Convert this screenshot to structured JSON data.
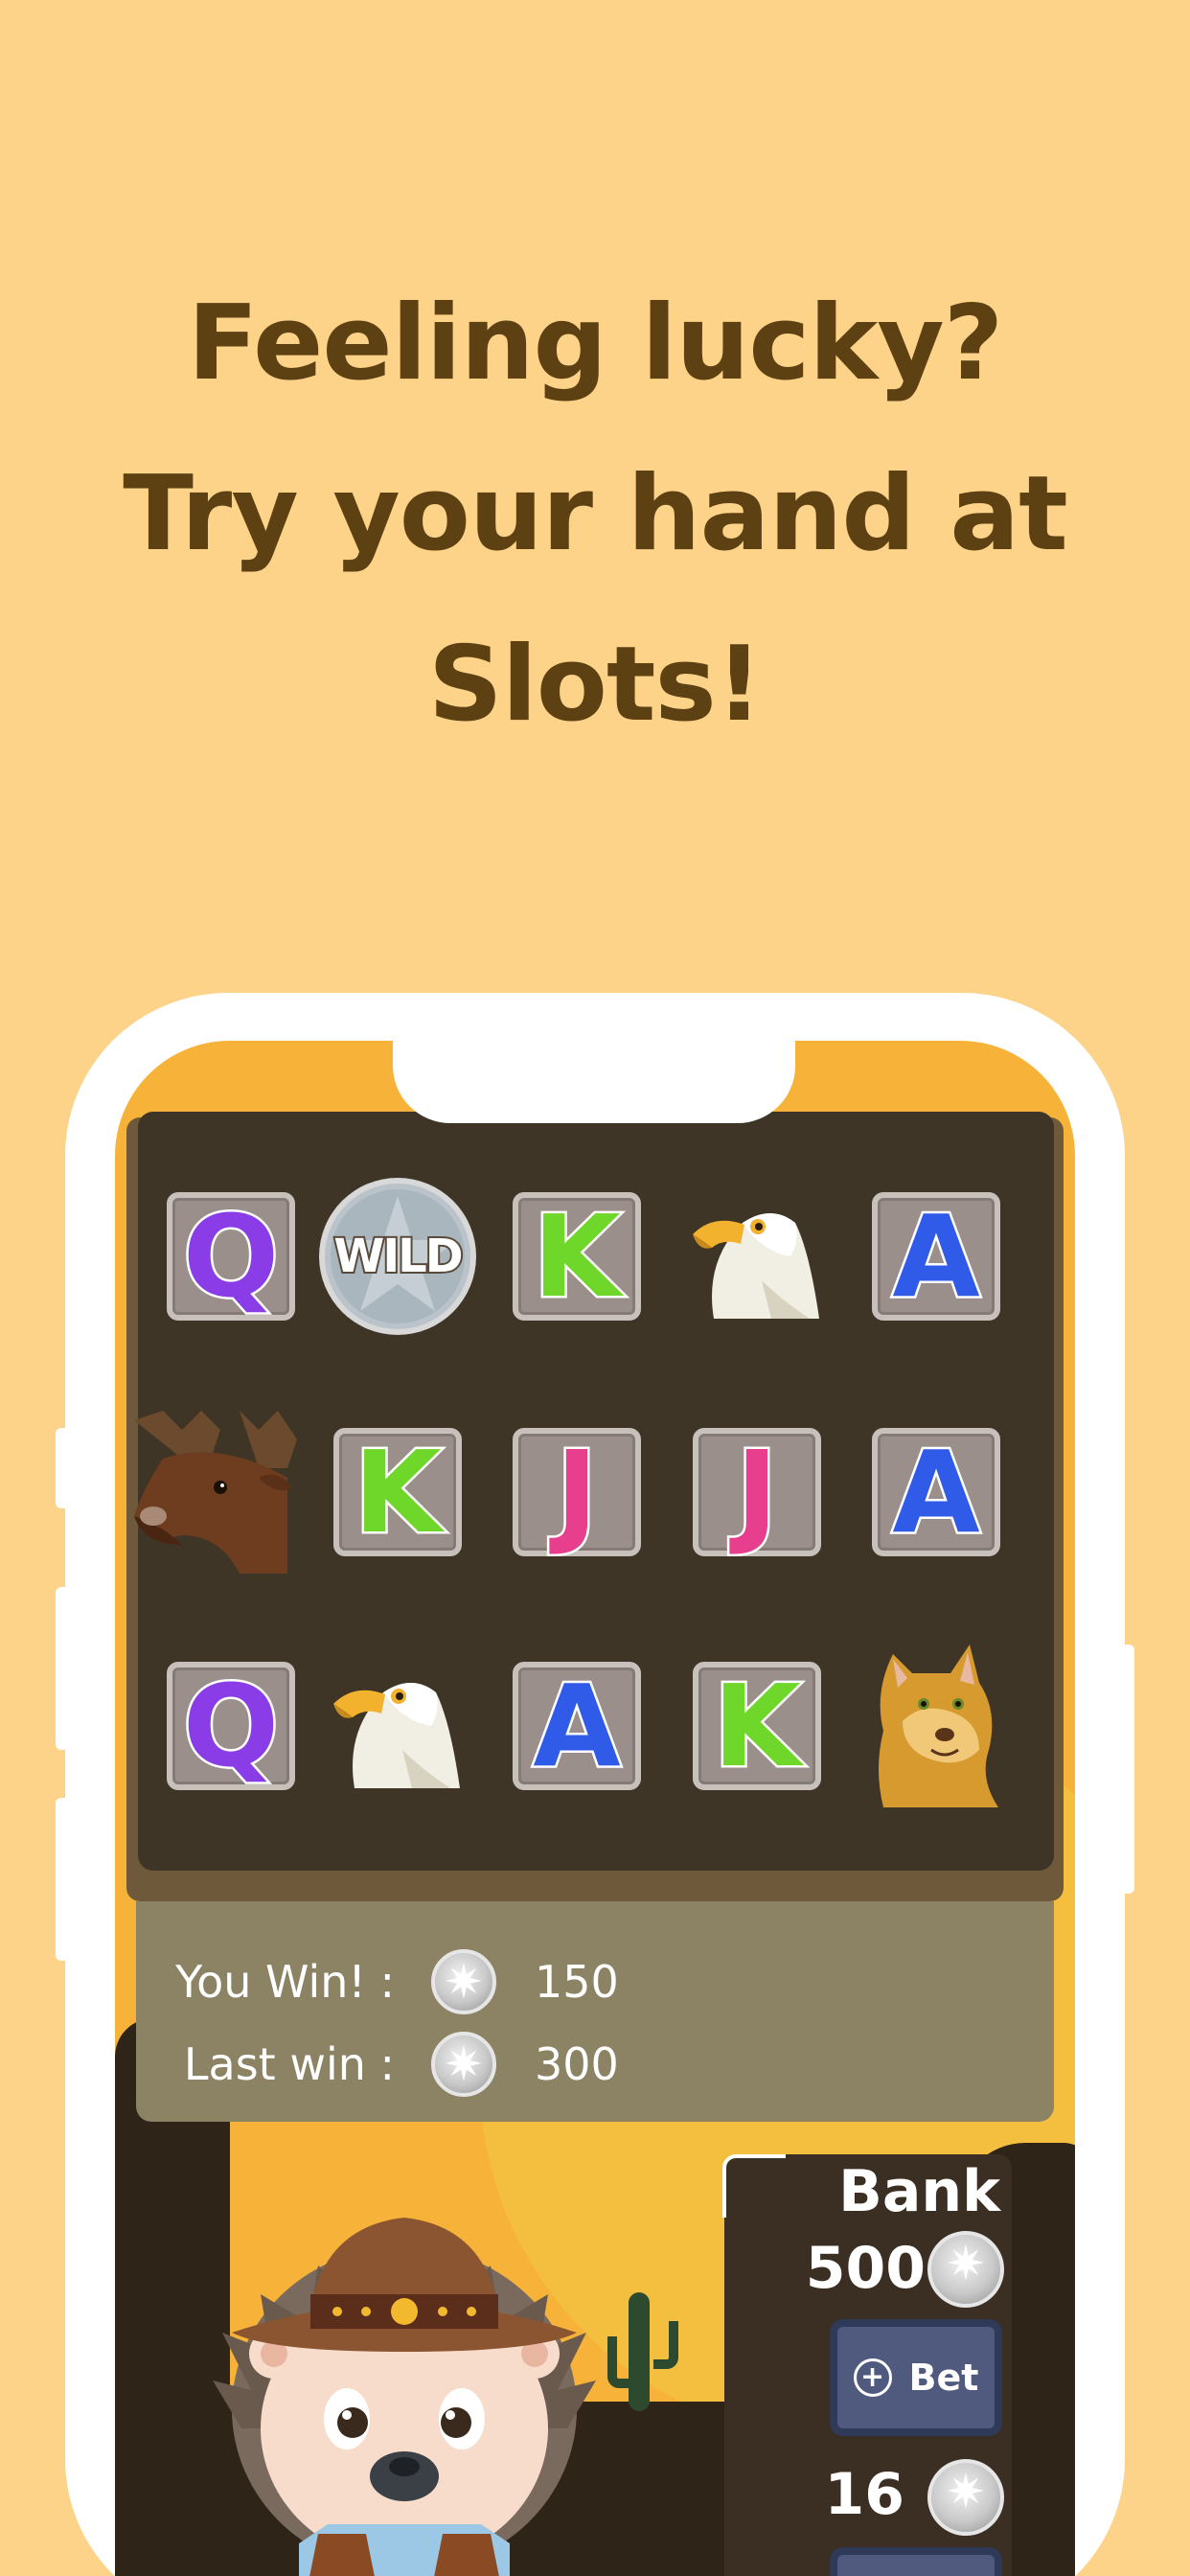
{
  "headline": {
    "line1": "Feeling lucky?",
    "line2": "Try your hand at",
    "line3": "Slots!"
  },
  "reels": [
    [
      {
        "type": "letter",
        "label": "Q",
        "color": "#8A3CE6"
      },
      {
        "type": "wild",
        "label": "WILD"
      },
      {
        "type": "letter",
        "label": "K",
        "color": "#6FD62A"
      },
      {
        "type": "eagle"
      },
      {
        "type": "letter",
        "label": "A",
        "color": "#2F5BE8"
      }
    ],
    [
      {
        "type": "moose"
      },
      {
        "type": "letter",
        "label": "K",
        "color": "#6FD62A"
      },
      {
        "type": "letter",
        "label": "J",
        "color": "#E83E8E"
      },
      {
        "type": "letter",
        "label": "J",
        "color": "#E83E8E"
      },
      {
        "type": "letter",
        "label": "A",
        "color": "#2F5BE8"
      }
    ],
    [
      {
        "type": "letter",
        "label": "Q",
        "color": "#8A3CE6"
      },
      {
        "type": "eagle"
      },
      {
        "type": "letter",
        "label": "A",
        "color": "#2F5BE8"
      },
      {
        "type": "letter",
        "label": "K",
        "color": "#6FD62A"
      },
      {
        "type": "cougar"
      }
    ]
  ],
  "results": {
    "you_win_label": "You Win! :",
    "you_win_value": "150",
    "last_win_label": "Last win :",
    "last_win_value": "300"
  },
  "bank": {
    "title": "Bank",
    "amount": "500",
    "bet_button": "Bet",
    "bet_amount": "16"
  },
  "colors": {
    "background": "#FDD389",
    "headline": "#5E4113",
    "reels_bg": "#3E3527",
    "accent": "#F7B23A"
  }
}
